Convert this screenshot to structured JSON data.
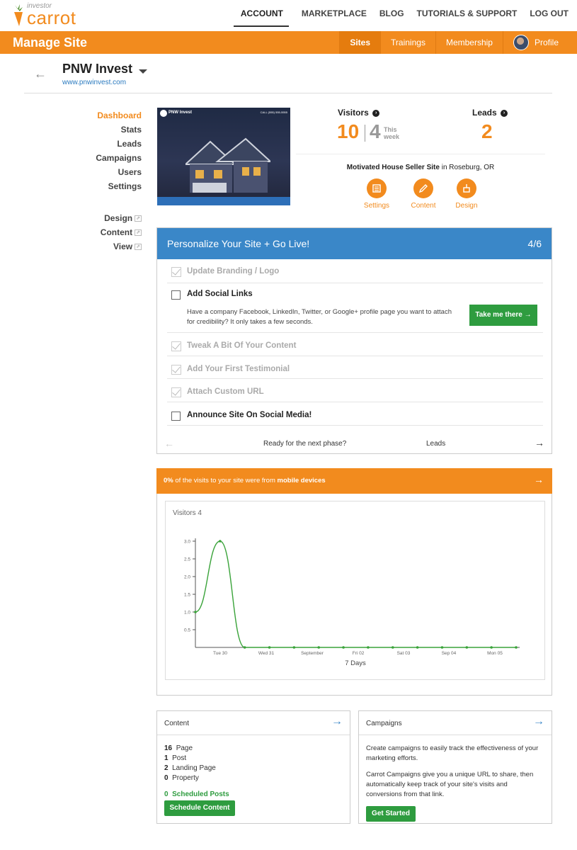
{
  "brand": {
    "small": "investor",
    "big": "carrot"
  },
  "topnav": [
    "ACCOUNT",
    "MARKETPLACE",
    "BLOG",
    "TUTORIALS & SUPPORT",
    "LOG OUT"
  ],
  "orangebar": {
    "title": "Manage Site",
    "nav": [
      "Sites",
      "Trainings",
      "Membership"
    ],
    "profile": "Profile"
  },
  "site": {
    "name": "PNW Invest",
    "url": "www.pnwinvest.com"
  },
  "sidenav": {
    "main": [
      "Dashboard",
      "Stats",
      "Leads",
      "Campaigns",
      "Users",
      "Settings"
    ],
    "secondary": [
      "Design",
      "Content",
      "View"
    ]
  },
  "thumb": {
    "name": "PNW Invest",
    "call": "CALL (555) 555-5555"
  },
  "stats": {
    "visitors_label": "Visitors",
    "visitors_total": "10",
    "visitors_week": "4",
    "this_week": "This week",
    "leads_label": "Leads",
    "leads_total": "2",
    "site_type": "Motivated House Seller Site",
    "site_location": " in Roseburg, OR",
    "actions": [
      "Settings",
      "Content",
      "Design"
    ]
  },
  "checklist": {
    "title": "Personalize Your Site + Go Live!",
    "progress": "4/6",
    "items": [
      {
        "label": "Update Branding / Logo",
        "done": true
      },
      {
        "label": "Add Social Links",
        "done": false
      },
      {
        "label": "Tweak A Bit Of Your Content",
        "done": true
      },
      {
        "label": "Add Your First Testimonial",
        "done": true
      },
      {
        "label": "Attach Custom URL",
        "done": true
      },
      {
        "label": "Announce Site On Social Media!",
        "done": false
      }
    ],
    "social_desc": "Have a company Facebook, LinkedIn, Twitter, or Google+ profile page you want to attach for credibility? It only takes a few seconds.",
    "take_button": "Take me there →",
    "footer_question": "Ready for the next phase?",
    "footer_next": "Leads"
  },
  "mobile": {
    "pct": "0%",
    "text1": " of the visits to your site were from ",
    "text2": "mobile devices"
  },
  "chart_title": "Visitors 4",
  "chart_data": {
    "type": "line",
    "title": "Visitors 4",
    "xlabel": "7 Days",
    "ylabel": "",
    "x_ticks": [
      "Tue 30",
      "Wed 31",
      "September",
      "Fri 02",
      "Sat 03",
      "Sep 04",
      "Mon 05"
    ],
    "y_ticks": [
      "0.5",
      "1.0",
      "1.5",
      "2.0",
      "2.5",
      "3.0"
    ],
    "ylim": [
      0,
      3
    ],
    "series": [
      {
        "values": [
          1,
          3,
          0,
          0,
          0,
          0,
          0,
          0,
          0,
          0,
          0,
          0,
          0,
          0
        ]
      }
    ],
    "color": "#3aa33a"
  },
  "content_card": {
    "title": "Content",
    "rows": [
      {
        "n": "16",
        "label": "Page"
      },
      {
        "n": "1",
        "label": "Post"
      },
      {
        "n": "2",
        "label": "Landing Page"
      },
      {
        "n": "0",
        "label": "Property"
      }
    ],
    "scheduled_n": "0",
    "scheduled_label": "Scheduled Posts",
    "button": "Schedule Content"
  },
  "campaigns_card": {
    "title": "Campaigns",
    "p1": "Create campaigns to easily track the effectiveness of your marketing efforts.",
    "p2": "Carrot Campaigns give you a unique URL to share, then automatically keep track of your site's visits and conversions from that link.",
    "button": "Get Started"
  },
  "colors": {
    "accent": "#f28b1e",
    "blue": "#3a87c8",
    "green": "#2e9c3f"
  }
}
